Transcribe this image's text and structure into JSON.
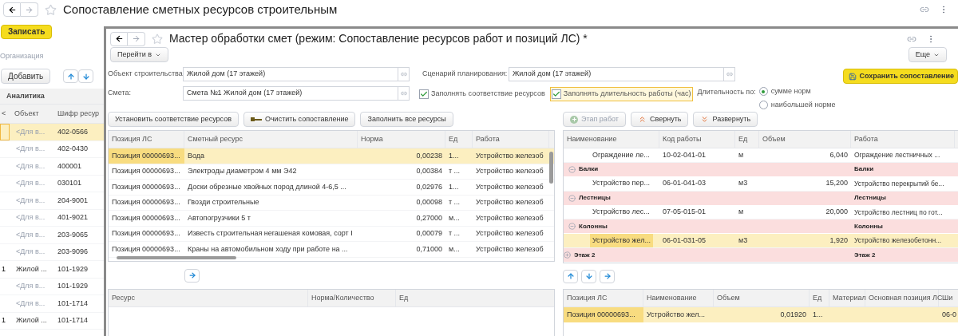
{
  "background_window": {
    "title": "Сопоставление сметных ресурсов строительным",
    "save_button": "Записать",
    "organization": {
      "placeholder": "Организация"
    },
    "add_button": "Добавить",
    "table": {
      "group_header": "Аналитика",
      "columns": [
        "<",
        "Объект",
        "Шифр ресур"
      ],
      "rows": [
        {
          "marker": "",
          "object": "<Для в...",
          "dimmed": true,
          "code": "402-0566",
          "selected": true
        },
        {
          "marker": "",
          "object": "<Для в...",
          "dimmed": true,
          "code": "402-0430",
          "selected": false
        },
        {
          "marker": "",
          "object": "<Для в...",
          "dimmed": true,
          "code": "400001",
          "selected": false
        },
        {
          "marker": "",
          "object": "<Для в...",
          "dimmed": true,
          "code": "030101",
          "selected": false
        },
        {
          "marker": "",
          "object": "<Для в...",
          "dimmed": true,
          "code": "204-9001",
          "selected": false
        },
        {
          "marker": "",
          "object": "<Для в...",
          "dimmed": true,
          "code": "401-9021",
          "selected": false
        },
        {
          "marker": "",
          "object": "<Для в...",
          "dimmed": true,
          "code": "203-9065",
          "selected": false
        },
        {
          "marker": "",
          "object": "<Для в...",
          "dimmed": true,
          "code": "203-9096",
          "selected": false
        },
        {
          "marker": "1",
          "object": "Жилой ...",
          "dimmed": false,
          "code": "101-1929",
          "selected": false
        },
        {
          "marker": "",
          "object": "<Для в...",
          "dimmed": true,
          "code": "101-1929",
          "selected": false
        },
        {
          "marker": "",
          "object": "<Для в...",
          "dimmed": true,
          "code": "101-1714",
          "selected": false
        },
        {
          "marker": "1",
          "object": "Жилой ...",
          "dimmed": false,
          "code": "101-1714",
          "selected": false
        }
      ]
    }
  },
  "wizard": {
    "title": "Мастер обработки смет (режим: Сопоставление ресурсов работ и позиций ЛС) *",
    "goto_button": "Перейти в",
    "more_button": "Еще",
    "object_field": {
      "label": "Объект строительства:",
      "value": "Жилой дом (17 этажей)"
    },
    "estimate_field": {
      "label": "Смета:",
      "value": "Смета №1 Жилой дом (17 этажей)"
    },
    "scenario_field": {
      "label": "Сценарий планирования:",
      "value": "Жилой дом (17 этажей)"
    },
    "save_button": "Сохранить сопоставление",
    "checkboxes": [
      {
        "label": "Заполнять соответствие ресурсов",
        "checked": true,
        "focused": false
      },
      {
        "label": "Заполнять длительность работы (час)",
        "checked": true,
        "focused": true
      }
    ],
    "duration": {
      "label": "Длительность по:",
      "options": [
        {
          "label": "сумме норм",
          "selected": true
        },
        {
          "label": "наибольшей норме",
          "selected": false
        }
      ]
    },
    "left_buttons": [
      {
        "label": "Установить соответствие ресурсов",
        "kind": "plain"
      },
      {
        "label": "Очистить сопоставление",
        "kind": "clear"
      },
      {
        "label": "Заполнить все ресурсы",
        "kind": "plain"
      }
    ],
    "right_buttons": [
      {
        "label": "Этап работ",
        "kind": "add",
        "disabled": true
      },
      {
        "label": "Свернуть",
        "kind": "collapse",
        "disabled": false
      },
      {
        "label": "Развернуть",
        "kind": "expand",
        "disabled": false
      }
    ],
    "resources_table": {
      "columns": [
        "Позиция ЛС",
        "Сметный ресурс",
        "Норма",
        "Ед",
        "Работа"
      ],
      "rows": [
        {
          "position": "Позиция 00000693...",
          "resource": "Вода",
          "norm": "0,00238",
          "unit": "1...",
          "work": "Устройство железоб",
          "selected": true
        },
        {
          "position": "Позиция 00000693...",
          "resource": "Электроды диаметром 4 мм Э42",
          "norm": "0,00384",
          "unit": "т ...",
          "work": "Устройство железоб",
          "selected": false
        },
        {
          "position": "Позиция 00000693...",
          "resource": "Доски обрезные хвойных пород длиной 4-6,5 ...",
          "norm": "0,02976",
          "unit": "1...",
          "work": "Устройство железоб",
          "selected": false
        },
        {
          "position": "Позиция 00000693...",
          "resource": "Гвозди строительные",
          "norm": "0,00098",
          "unit": "т ...",
          "work": "Устройство железоб",
          "selected": false
        },
        {
          "position": "Позиция 00000693...",
          "resource": "Автопогрузчики 5 т",
          "norm": "0,27000",
          "unit": "м...",
          "work": "Устройство железоб",
          "selected": false
        },
        {
          "position": "Позиция 00000693...",
          "resource": "Известь строительная негашеная комовая, сорт I",
          "norm": "0,00079",
          "unit": "т ...",
          "work": "Устройство железоб",
          "selected": false
        },
        {
          "position": "Позиция 00000693...",
          "resource": "Краны на автомобильном ходу при работе на ...",
          "norm": "0,71000",
          "unit": "м...",
          "work": "Устройство железоб",
          "selected": false
        }
      ]
    },
    "detail_table": {
      "columns": [
        "Ресурс",
        "Норма/Количество",
        "Ед"
      ]
    },
    "tree": {
      "columns": [
        "Наименование",
        "Код работы",
        "Ед",
        "Объем",
        "Работа"
      ],
      "rows": [
        {
          "children": [
            {
              "children": [
                {
                  "kind": "item",
                  "name": "Ограждение ле...",
                  "code": "10-02-041-01",
                  "unit": "м",
                  "volume": "6,040",
                  "work": "Ограждение лестничных ...",
                  "selected": false
                }
              ]
            },
            {
              "kind": "group",
              "name": "Балки",
              "work": "Балки",
              "expanded": true,
              "children": [
                {
                  "kind": "item",
                  "name": "Устройство пер...",
                  "code": "06-01-041-03",
                  "unit": "м3",
                  "volume": "15,200",
                  "work": "Устройство перекрытий бе...",
                  "selected": false
                }
              ]
            },
            {
              "kind": "group",
              "name": "Лестницы",
              "work": "Лестницы",
              "expanded": true,
              "children": [
                {
                  "kind": "item",
                  "name": "Устройство лес...",
                  "code": "07-05-015-01",
                  "unit": "м",
                  "volume": "20,000",
                  "work": "Устройство лестниц по гот...",
                  "selected": false
                }
              ]
            },
            {
              "kind": "group",
              "name": "Колонны",
              "work": "Колонны",
              "expanded": true,
              "children": [
                {
                  "kind": "item",
                  "name": "Устройство жел...",
                  "code": "06-01-031-05",
                  "unit": "м3",
                  "volume": "1,920",
                  "work": "Устройство железобетонн...",
                  "selected": true
                }
              ]
            }
          ]
        },
        {
          "kind": "group",
          "name": "Этаж 2",
          "work": "Этаж 2",
          "expanded": false
        }
      ]
    },
    "positions_table": {
      "columns": [
        "Позиция ЛС",
        "Наименование",
        "Объем",
        "Ед",
        "Материал",
        "Основная позиция ЛС",
        "Ши"
      ],
      "rows": [
        {
          "position": "Позиция 00000693...",
          "name": "Устройство жел...",
          "volume": "0,01920",
          "unit": "1...",
          "column_7": "06-0",
          "selected": true
        }
      ]
    }
  }
}
